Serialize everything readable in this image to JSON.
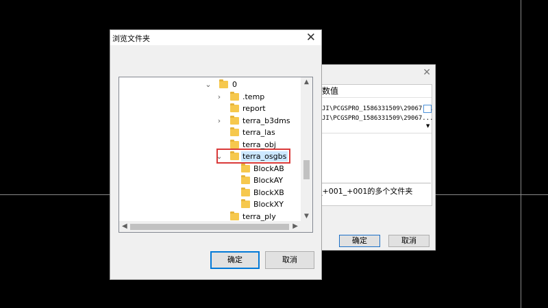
{
  "dialog": {
    "title": "浏览文件夹",
    "ok_label": "确定",
    "cancel_label": "取消",
    "tree": [
      {
        "label": "0",
        "depth": 0,
        "expander": "expanded"
      },
      {
        "label": ".temp",
        "depth": 1,
        "expander": "collapsed"
      },
      {
        "label": "report",
        "depth": 1,
        "expander": "none"
      },
      {
        "label": "terra_b3dms",
        "depth": 1,
        "expander": "collapsed"
      },
      {
        "label": "terra_las",
        "depth": 1,
        "expander": "none"
      },
      {
        "label": "terra_obj",
        "depth": 1,
        "expander": "none"
      },
      {
        "label": "terra_osgbs",
        "depth": 1,
        "expander": "expanded",
        "selected": true
      },
      {
        "label": "BlockAB",
        "depth": 2,
        "expander": "none"
      },
      {
        "label": "BlockAY",
        "depth": 2,
        "expander": "none"
      },
      {
        "label": "BlockXB",
        "depth": 2,
        "expander": "none"
      },
      {
        "label": "BlockXY",
        "depth": 2,
        "expander": "none"
      },
      {
        "label": "terra_ply",
        "depth": 1,
        "expander": "none"
      }
    ]
  },
  "back_dialog": {
    "close_glyph": "✕",
    "column_header": "数值",
    "path_1": "JI\\PCGSPRO_1586331509\\29067...",
    "path_2": "JI\\PCGSPRO_1586331509\\29067...",
    "description": "_+001_+001的多个文件夹",
    "ok_label": "确定",
    "cancel_label": "取消"
  },
  "colors": {
    "folder": "#f6c84d",
    "selection": "#cce8ff",
    "highlight_box": "#d93838",
    "accent": "#0078d7"
  }
}
